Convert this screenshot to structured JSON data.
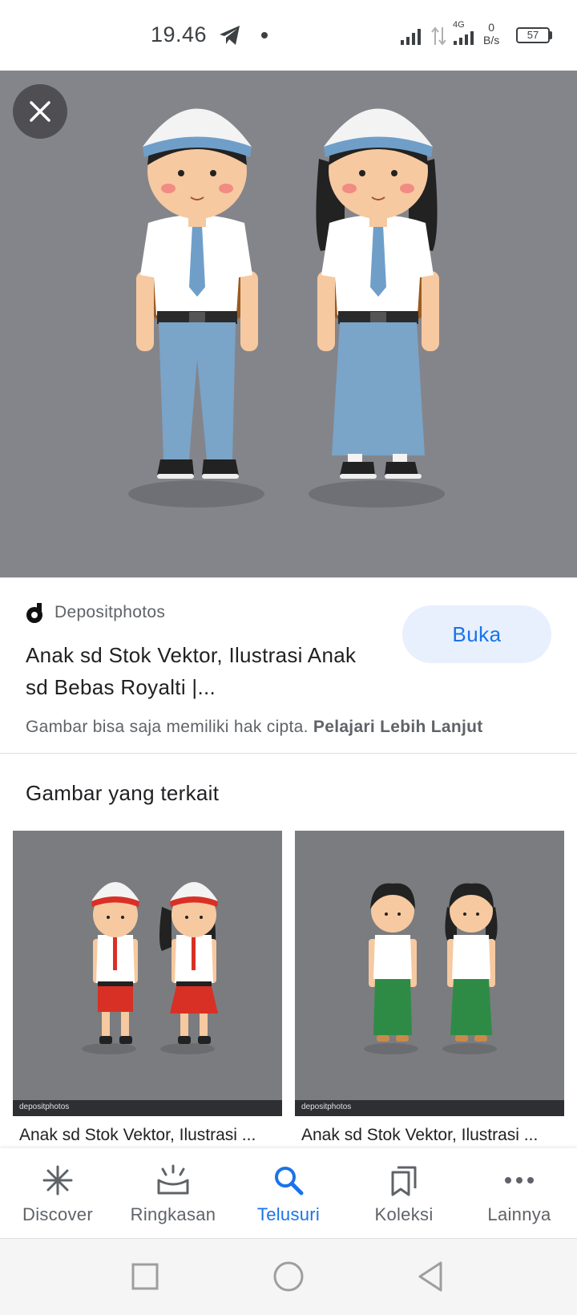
{
  "status_bar": {
    "time": "19.46",
    "network_type": "4G",
    "speed_value": "0",
    "speed_unit": "B/s",
    "battery": "57",
    "icons": [
      "telegram-icon",
      "dot-icon",
      "signal-icon",
      "data-arrows-icon",
      "signal-4g-icon",
      "battery-icon"
    ]
  },
  "viewer": {
    "close_icon": "close-icon",
    "background_color": "#84858a"
  },
  "result": {
    "source_name": "Depositphotos",
    "title": "Anak sd Stok Vektor, Ilustrasi Anak sd Bebas Royalti |...",
    "open_button": "Buka",
    "copyright_text": "Gambar bisa saja memiliki hak cipta.",
    "learn_more": "Pelajari Lebih Lanjut"
  },
  "related": {
    "heading": "Gambar yang terkait",
    "items": [
      {
        "caption": "Anak sd Stok Vektor, Ilustrasi ...",
        "watermark": "depositphotos"
      },
      {
        "caption": "Anak sd Stok Vektor, Ilustrasi ...",
        "watermark": "depositphotos"
      }
    ]
  },
  "bottom_nav": {
    "items": [
      {
        "label": "Discover",
        "icon": "asterisk-icon"
      },
      {
        "label": "Ringkasan",
        "icon": "updates-icon"
      },
      {
        "label": "Telusuri",
        "icon": "search-icon",
        "active": true
      },
      {
        "label": "Koleksi",
        "icon": "bookmarks-icon"
      },
      {
        "label": "Lainnya",
        "icon": "more-icon"
      }
    ],
    "active_color": "#1a73e8"
  },
  "system_nav": {
    "icons": [
      "recents-icon",
      "home-icon",
      "back-icon"
    ]
  }
}
